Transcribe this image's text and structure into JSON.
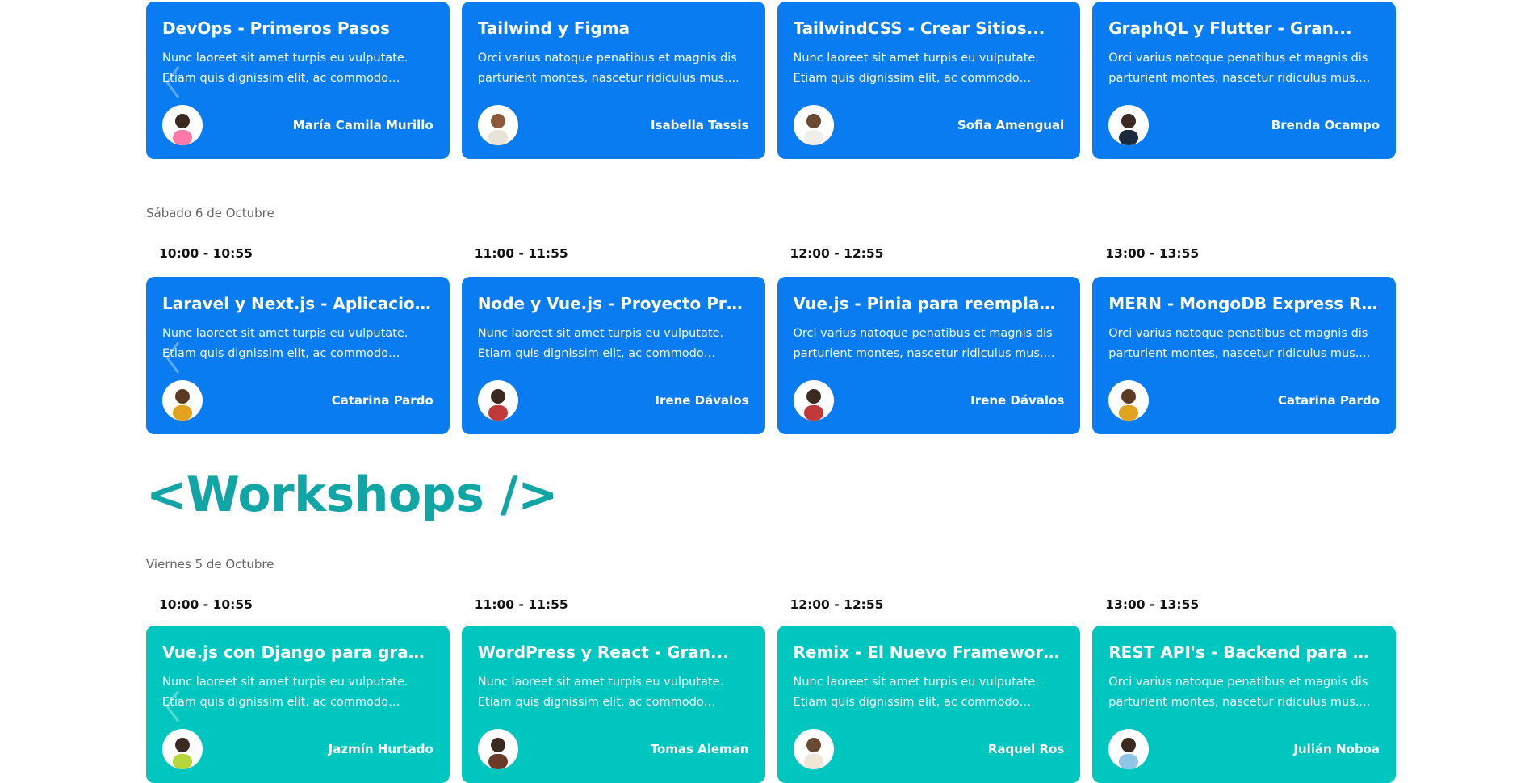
{
  "colors": {
    "talk": "#0a7cf2",
    "workshop": "#00c6c0",
    "heading": "#12a5a6"
  },
  "row1": {
    "cards": [
      {
        "title": "DevOps - Primeros Pasos",
        "desc": "Nunc laoreet sit amet turpis eu vulputate. Etiam quis dignissim elit, ac commodo ligula....",
        "speaker": "María Camila Murillo",
        "avatar": "avatar-photo"
      },
      {
        "title": "Tailwind y Figma",
        "desc": "Orci varius natoque penatibus et magnis dis parturient montes, nascetur ridiculus mus....",
        "speaker": "Isabella Tassis",
        "avatar": "avatar-photo"
      },
      {
        "title": "TailwindCSS - Crear Sitios...",
        "desc": "Nunc laoreet sit amet turpis eu vulputate. Etiam quis dignissim elit, ac commodo ligula....",
        "speaker": "Sofia Amengual",
        "avatar": "avatar-photo"
      },
      {
        "title": "GraphQL y Flutter - Gran...",
        "desc": "Orci varius natoque penatibus et magnis dis parturient montes, nascetur ridiculus mus....",
        "speaker": "Brenda Ocampo",
        "avatar": "avatar-photo"
      }
    ]
  },
  "saturday": {
    "day": "Sábado 6 de Octubre",
    "times": [
      "10:00 - 10:55",
      "11:00 - 11:55",
      "12:00 - 12:55",
      "13:00 - 13:55"
    ],
    "cards": [
      {
        "title": "Laravel y Next.js - Aplicaciones Fu...",
        "desc": "Nunc laoreet sit amet turpis eu vulputate. Etiam quis dignissim elit, ac commodo ligula....",
        "speaker": "Catarina Pardo"
      },
      {
        "title": "Node y Vue.js - Proyecto Práctico",
        "desc": "Nunc laoreet sit amet turpis eu vulputate. Etiam quis dignissim elit, ac commodo ligula....",
        "speaker": "Irene Dávalos"
      },
      {
        "title": "Vue.js - Pinia para reemplazar Vuex",
        "desc": "Orci varius natoque penatibus et magnis dis parturient montes, nascetur ridiculus mus....",
        "speaker": "Irene Dávalos"
      },
      {
        "title": "MERN - MongoDB Express React y...",
        "desc": "Orci varius natoque penatibus et magnis dis parturient montes, nascetur ridiculus mus....",
        "speaker": "Catarina Pardo"
      }
    ]
  },
  "workshops": {
    "title": "<Workshops />",
    "day": "Viernes 5 de Octubre",
    "times": [
      "10:00 - 10:55",
      "11:00 - 11:55",
      "12:00 - 12:55",
      "13:00 - 13:55"
    ],
    "cards": [
      {
        "title": "Vue.js con Django para gran...",
        "desc": "Nunc laoreet sit amet turpis eu vulputate. Etiam quis dignissim elit, ac commodo ligula....",
        "speaker": "Jazmín Hurtado"
      },
      {
        "title": "WordPress y React - Gran...",
        "desc": "Nunc laoreet sit amet turpis eu vulputate. Etiam quis dignissim elit, ac commodo ligula....",
        "speaker": "Tomas Aleman"
      },
      {
        "title": "Remix - El Nuevo Framework de...",
        "desc": "Nunc laoreet sit amet turpis eu vulputate. Etiam quis dignissim elit, ac commodo ligula....",
        "speaker": "Raquel Ros"
      },
      {
        "title": "REST API's - Backend para Web y...",
        "desc": "Orci varius natoque penatibus et magnis dis parturient montes, nascetur ridiculus mus....",
        "speaker": "Julián Noboa"
      }
    ]
  },
  "icons": {
    "prev": "chevron-left-icon",
    "next": "chevron-right-icon"
  }
}
